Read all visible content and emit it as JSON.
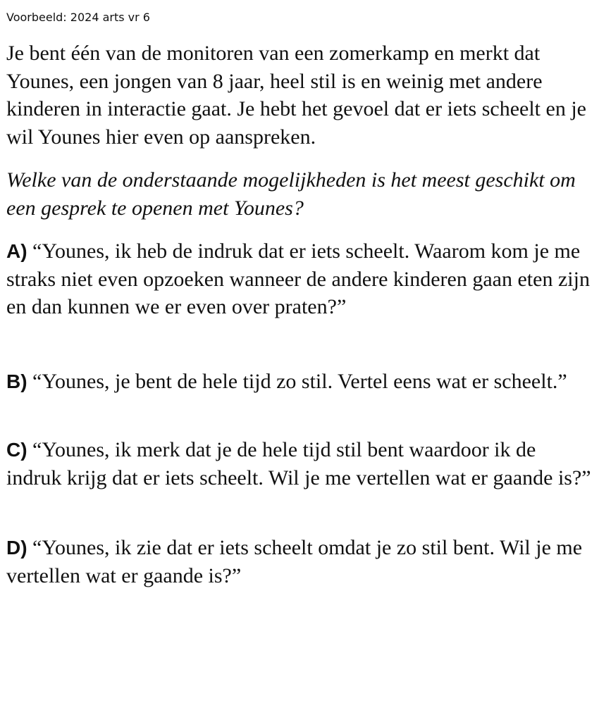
{
  "header": {
    "source_label": "Voorbeeld: 2024 arts vr 6"
  },
  "question": {
    "scenario": "Je bent één van de monitoren van een zomerkamp en merkt dat Younes, een jongen van 8 jaar, heel stil is en weinig met andere kinderen in interactie gaat. Je hebt het gevoel dat er iets scheelt en je wil Younes hier even op aanspreken.",
    "prompt": "Welke van de onderstaande mogelijkheden is het meest geschikt om een gesprek te openen met Younes?",
    "options": [
      {
        "letter": "A)",
        "text": "“Younes, ik heb de indruk dat er iets scheelt. Waarom kom je me straks niet even opzoeken wanneer de andere kinderen gaan eten zijn en dan kunnen we er even over praten?”"
      },
      {
        "letter": "B)",
        "text": "“Younes, je bent de hele tijd zo stil. Vertel eens wat er scheelt.”"
      },
      {
        "letter": "C)",
        "text": "“Younes, ik merk dat je de hele tijd stil bent waardoor ik de indruk krijg dat er iets scheelt. Wil je me vertellen wat er gaande is?”"
      },
      {
        "letter": "D)",
        "text": "“Younes, ik zie dat er iets scheelt omdat je zo stil bent. Wil je me vertellen wat er gaande is?”"
      }
    ]
  }
}
